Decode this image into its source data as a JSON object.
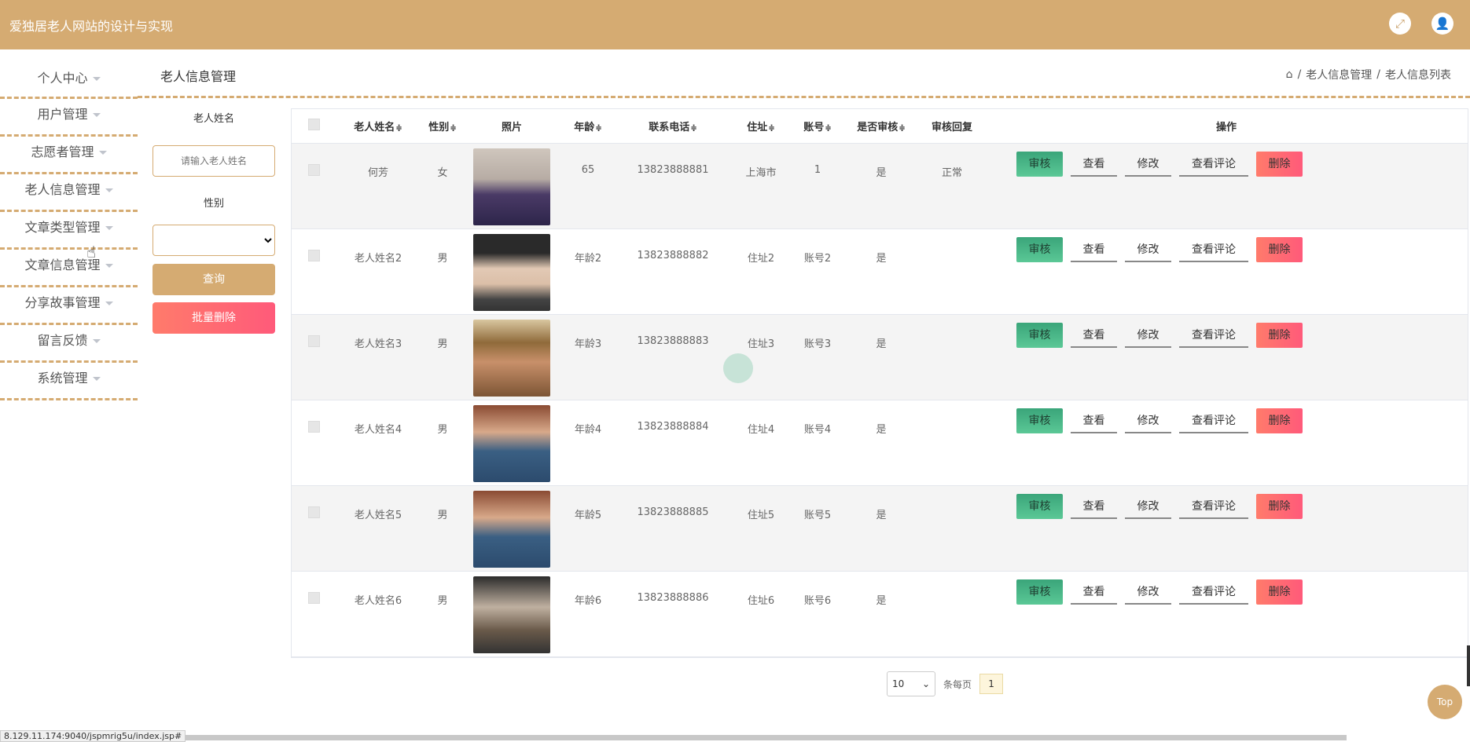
{
  "header": {
    "title": "爱独居老人网站的设计与实现"
  },
  "sidebar": {
    "items": [
      "个人中心",
      "用户管理",
      "志愿者管理",
      "老人信息管理",
      "文章类型管理",
      "文章信息管理",
      "分享故事管理",
      "留言反馈",
      "系统管理"
    ]
  },
  "page": {
    "title": "老人信息管理"
  },
  "breadcrumb": {
    "home_icon": "home-icon",
    "level1": "老人信息管理",
    "sep": "/",
    "level2": "老人信息列表"
  },
  "search": {
    "name_label": "老人姓名",
    "name_placeholder": "请输入老人姓名",
    "gender_label": "性别",
    "query_button": "查询",
    "batch_delete_button": "批量删除"
  },
  "table": {
    "headers": {
      "name": "老人姓名",
      "gender": "性别",
      "photo": "照片",
      "age": "年龄",
      "phone": "联系电话",
      "address": "住址",
      "account": "账号",
      "audited": "是否审核",
      "reply": "审核回复",
      "actions": "操作"
    },
    "sort_icon": "≑",
    "rows": [
      {
        "name": "何芳",
        "gender": "女",
        "age": "65",
        "phone": "13823888881",
        "address": "上海市",
        "account": "1",
        "audited": "是",
        "reply": "正常"
      },
      {
        "name": "老人姓名2",
        "gender": "男",
        "age": "年龄2",
        "phone": "13823888882",
        "address": "住址2",
        "account": "账号2",
        "audited": "是",
        "reply": ""
      },
      {
        "name": "老人姓名3",
        "gender": "男",
        "age": "年龄3",
        "phone": "13823888883",
        "address": "住址3",
        "account": "账号3",
        "audited": "是",
        "reply": ""
      },
      {
        "name": "老人姓名4",
        "gender": "男",
        "age": "年龄4",
        "phone": "13823888884",
        "address": "住址4",
        "account": "账号4",
        "audited": "是",
        "reply": ""
      },
      {
        "name": "老人姓名5",
        "gender": "男",
        "age": "年龄5",
        "phone": "13823888885",
        "address": "住址5",
        "account": "账号5",
        "audited": "是",
        "reply": ""
      },
      {
        "name": "老人姓名6",
        "gender": "男",
        "age": "年龄6",
        "phone": "13823888886",
        "address": "住址6",
        "account": "账号6",
        "audited": "是",
        "reply": ""
      }
    ],
    "actions": {
      "audit": "审核",
      "view": "查看",
      "edit": "修改",
      "comments": "查看评论",
      "delete": "删除"
    }
  },
  "pagination": {
    "page_size": "10",
    "per_page_label": "条每页",
    "current_page": "1"
  },
  "top_button": "Top",
  "status_url": "8.129.11.174:9040/jspmrig5u/index.jsp#",
  "colors": {
    "brand": "#d5ab72",
    "audit_green": "#3aa57a",
    "delete_red": "#ff5a7a"
  }
}
